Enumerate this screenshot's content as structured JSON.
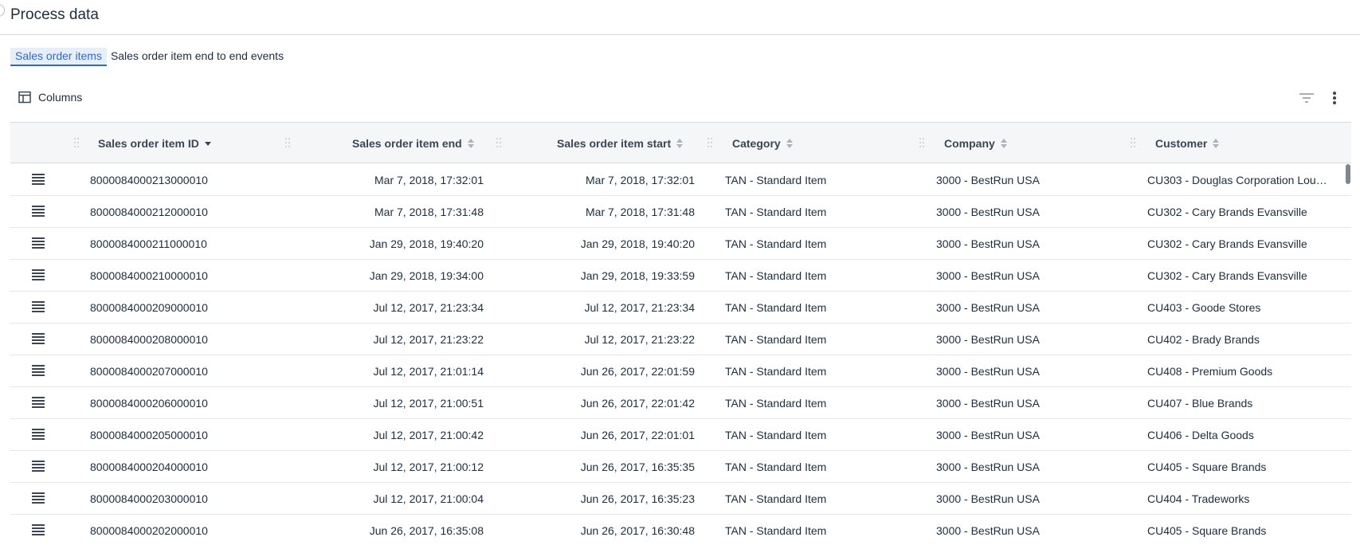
{
  "page": {
    "title": "Process data"
  },
  "tabs": [
    {
      "label": "Sales order items",
      "active": true
    },
    {
      "label": "Sales order item end to end events",
      "active": false
    }
  ],
  "toolbar": {
    "columns_label": "Columns",
    "columns_icon": "table-columns-icon",
    "filter_icon": "filter-icon",
    "more_icon": "more-vertical-icon"
  },
  "table": {
    "columns": [
      {
        "label": "Sales order item ID",
        "sort": "desc"
      },
      {
        "label": "Sales order item end",
        "sort": "none"
      },
      {
        "label": "Sales order item start",
        "sort": "none"
      },
      {
        "label": "Category",
        "sort": "none"
      },
      {
        "label": "Company",
        "sort": "none"
      },
      {
        "label": "Customer",
        "sort": "none"
      }
    ],
    "rows": [
      {
        "id": "8000084000213000010",
        "end": "Mar 7, 2018, 17:32:01",
        "start": "Mar 7, 2018, 17:32:01",
        "category": "TAN - Standard Item",
        "company": "3000 - BestRun USA",
        "customer": "CU303 - Douglas Corporation Lou…"
      },
      {
        "id": "8000084000212000010",
        "end": "Mar 7, 2018, 17:31:48",
        "start": "Mar 7, 2018, 17:31:48",
        "category": "TAN - Standard Item",
        "company": "3000 - BestRun USA",
        "customer": "CU302 - Cary Brands Evansville"
      },
      {
        "id": "8000084000211000010",
        "end": "Jan 29, 2018, 19:40:20",
        "start": "Jan 29, 2018, 19:40:20",
        "category": "TAN - Standard Item",
        "company": "3000 - BestRun USA",
        "customer": "CU302 - Cary Brands Evansville"
      },
      {
        "id": "8000084000210000010",
        "end": "Jan 29, 2018, 19:34:00",
        "start": "Jan 29, 2018, 19:33:59",
        "category": "TAN - Standard Item",
        "company": "3000 - BestRun USA",
        "customer": "CU302 - Cary Brands Evansville"
      },
      {
        "id": "8000084000209000010",
        "end": "Jul 12, 2017, 21:23:34",
        "start": "Jul 12, 2017, 21:23:34",
        "category": "TAN - Standard Item",
        "company": "3000 - BestRun USA",
        "customer": "CU403 - Goode Stores"
      },
      {
        "id": "8000084000208000010",
        "end": "Jul 12, 2017, 21:23:22",
        "start": "Jul 12, 2017, 21:23:22",
        "category": "TAN - Standard Item",
        "company": "3000 - BestRun USA",
        "customer": "CU402 - Brady Brands"
      },
      {
        "id": "8000084000207000010",
        "end": "Jul 12, 2017, 21:01:14",
        "start": "Jun 26, 2017, 22:01:59",
        "category": "TAN - Standard Item",
        "company": "3000 - BestRun USA",
        "customer": "CU408 - Premium Goods"
      },
      {
        "id": "8000084000206000010",
        "end": "Jul 12, 2017, 21:00:51",
        "start": "Jun 26, 2017, 22:01:42",
        "category": "TAN - Standard Item",
        "company": "3000 - BestRun USA",
        "customer": "CU407 - Blue Brands"
      },
      {
        "id": "8000084000205000010",
        "end": "Jul 12, 2017, 21:00:42",
        "start": "Jun 26, 2017, 22:01:01",
        "category": "TAN - Standard Item",
        "company": "3000 - BestRun USA",
        "customer": "CU406 - Delta Goods"
      },
      {
        "id": "8000084000204000010",
        "end": "Jul 12, 2017, 21:00:12",
        "start": "Jun 26, 2017, 16:35:35",
        "category": "TAN - Standard Item",
        "company": "3000 - BestRun USA",
        "customer": "CU405 - Square Brands"
      },
      {
        "id": "8000084000203000010",
        "end": "Jul 12, 2017, 21:00:04",
        "start": "Jun 26, 2017, 16:35:23",
        "category": "TAN - Standard Item",
        "company": "3000 - BestRun USA",
        "customer": "CU404 - Tradeworks"
      },
      {
        "id": "8000084000202000010",
        "end": "Jun 26, 2017, 16:35:08",
        "start": "Jun 26, 2017, 16:30:48",
        "category": "TAN - Standard Item",
        "company": "3000 - BestRun USA",
        "customer": "CU405 - Square Brands"
      }
    ]
  },
  "colors": {
    "accent": "#3468c7",
    "header_bg": "#f5f6f7",
    "text": "#1d2d3e"
  }
}
